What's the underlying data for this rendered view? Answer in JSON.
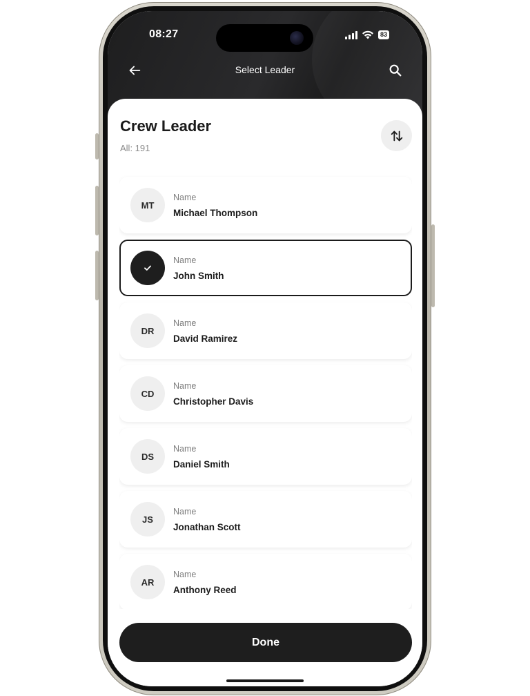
{
  "status_bar": {
    "time": "08:27",
    "battery": "83"
  },
  "nav": {
    "title": "Select Leader"
  },
  "header": {
    "title": "Crew Leader",
    "count": "All: 191"
  },
  "list": {
    "items": [
      {
        "initials": "MT",
        "label": "Name",
        "name": "Michael Thompson",
        "selected": false
      },
      {
        "initials": "",
        "label": "Name",
        "name": "John Smith",
        "selected": true
      },
      {
        "initials": "DR",
        "label": "Name",
        "name": "David Ramirez",
        "selected": false
      },
      {
        "initials": "CD",
        "label": "Name",
        "name": "Christopher Davis",
        "selected": false
      },
      {
        "initials": "DS",
        "label": "Name",
        "name": "Daniel Smith",
        "selected": false
      },
      {
        "initials": "JS",
        "label": "Name",
        "name": "Jonathan Scott",
        "selected": false
      },
      {
        "initials": "AR",
        "label": "Name",
        "name": "Anthony Reed",
        "selected": false
      }
    ]
  },
  "footer": {
    "done_label": "Done"
  },
  "icons": {
    "back": "arrow-left-icon",
    "search": "search-icon",
    "sort": "sort-arrows-icon",
    "selected": "check-icon"
  },
  "colors": {
    "primary": "#1e1e1e",
    "avatar_bg": "#efefef",
    "secondary_text": "#7d7d7d"
  }
}
